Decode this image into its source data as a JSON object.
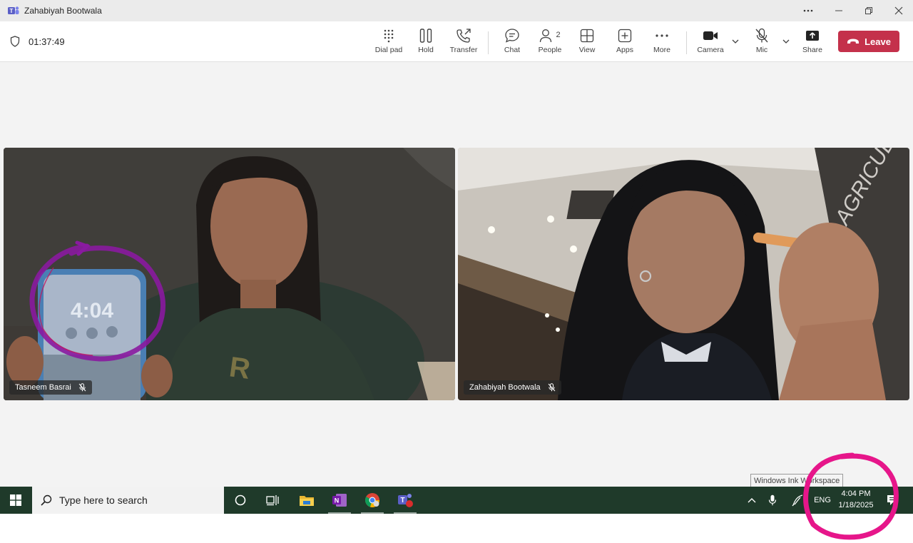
{
  "window": {
    "title": "Zahabiyah Bootwala"
  },
  "call": {
    "duration": "01:37:49"
  },
  "toolbar": {
    "dialpad": "Dial pad",
    "hold": "Hold",
    "transfer": "Transfer",
    "chat": "Chat",
    "people": "People",
    "people_count": "2",
    "view": "View",
    "apps": "Apps",
    "more": "More",
    "camera": "Camera",
    "mic": "Mic",
    "share": "Share",
    "leave": "Leave"
  },
  "participants": [
    {
      "name": "Tasneem Basrai",
      "muted": true
    },
    {
      "name": "Zahabiyah Bootwala",
      "muted": true
    }
  ],
  "tooltip": {
    "text": "Windows Ink Workspace"
  },
  "taskbar": {
    "search_placeholder": "Type here to search",
    "language": "ENG",
    "time": "4:04 PM",
    "date": "1/18/2025",
    "apps": [
      "cortana-icon",
      "task-view-icon",
      "file-explorer-icon",
      "onenote-icon",
      "chrome-icon",
      "teams-icon"
    ]
  },
  "colors": {
    "leave_button": "#c4314b",
    "taskbar": "#1f3a2a",
    "ink_magenta": "#e6168a",
    "ink_purple": "#8a1aa0"
  }
}
